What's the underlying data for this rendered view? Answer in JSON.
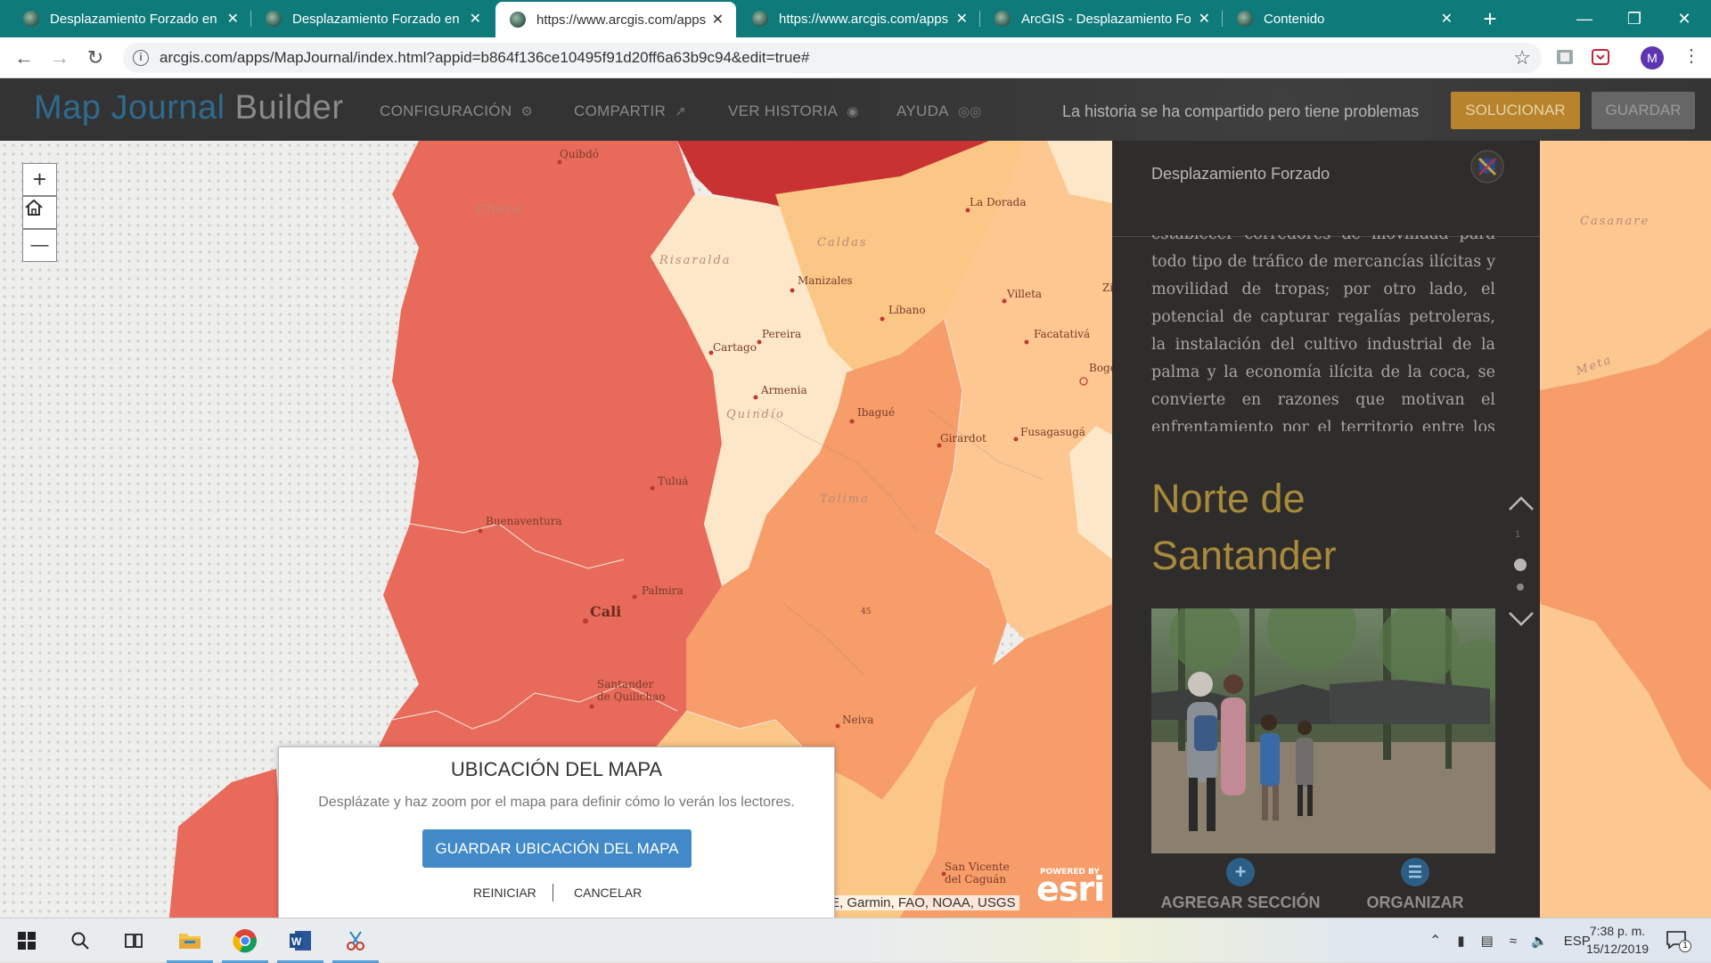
{
  "browser": {
    "tabs": [
      {
        "title": "Desplazamiento Forzado en C",
        "close": "✕"
      },
      {
        "title": "Desplazamiento Forzado en C",
        "close": "✕"
      },
      {
        "title": "https://www.arcgis.com/apps",
        "close": "✕"
      },
      {
        "title": "https://www.arcgis.com/apps",
        "close": "✕"
      },
      {
        "title": "ArcGIS - Desplazamiento For",
        "close": "✕"
      },
      {
        "title": "Contenido",
        "close": "✕"
      }
    ],
    "new_tab": "+",
    "url": "arcgis.com/apps/MapJournal/index.html?appid=b864f136ce10495f91d20ff6a63b9c94&edit=true#",
    "avatar_initial": "M"
  },
  "builder": {
    "logo_a": "Map Journal",
    "logo_b": " Builder",
    "menu": {
      "settings": "CONFIGURACIÓN",
      "share": "COMPARTIR",
      "view_story": "VER HISTORIA",
      "help": "AYUDA"
    },
    "status_text": "La historia se ha compartido pero tiene problemas",
    "fix_label": "SOLUCIONAR",
    "save_label": "GUARDAR"
  },
  "map": {
    "zoom_in": "+",
    "zoom_out": "—",
    "attribution": "E, Garmin, FAO, NOAA, USGS",
    "powered_by": "POWERED BY",
    "esri": "esri",
    "cities": [
      "Quibdó",
      "La Dorada",
      "Manizales",
      "Villeta",
      "Pereira",
      "Líbano",
      "Facatativá",
      "Cartago",
      "Armenia",
      "Ibagué",
      "Bogo",
      "Girardot",
      "Fusagasugá",
      "Tuluá",
      "Buenaventura",
      "Palmira",
      "Cali",
      "Santander de Quilichao",
      "Neiva",
      "San Vicente del Caguán",
      "45",
      "Zi"
    ],
    "departments": [
      "Chocó",
      "Caldas",
      "Risaralda",
      "Quindío",
      "Tolima",
      "Casanare",
      "Meta"
    ]
  },
  "panel": {
    "title": "Desplazamiento Forzado",
    "body": "establecer corredores de movilidad para todo tipo de tráfico de mercancías ilícitas y movilidad de tropas; por otro lado, el potencial de capturar regalías petroleras, la instalación del cultivo industrial de la palma y la economía ilícita de la coca, se convierte en razones que motivan el enfrentamiento por el territorio entre los actores armados. Esta confluencia de factores estructurales",
    "section_title": "Norte de Santander",
    "page_number": "1",
    "add_section": "AGREGAR SECCIÓN",
    "organize": "ORGANIZAR"
  },
  "dialog": {
    "title": "UBICACIÓN DEL MAPA",
    "description": "Desplázate y haz zoom por el mapa para definir cómo lo verán los lectores.",
    "save": "GUARDAR UBICACIÓN DEL MAPA",
    "reset": "REINICIAR",
    "cancel": "CANCELAR"
  },
  "taskbar": {
    "language": "ESP",
    "time": "7:38 p. m.",
    "date": "15/12/2019",
    "notifications": "1"
  },
  "colors": {
    "tab_bar": "#0e7a7a",
    "builder_bg": "#333333",
    "fix_button": "#b7832d",
    "dialog_button": "#4189c7",
    "section_title": "#a98a3a"
  }
}
